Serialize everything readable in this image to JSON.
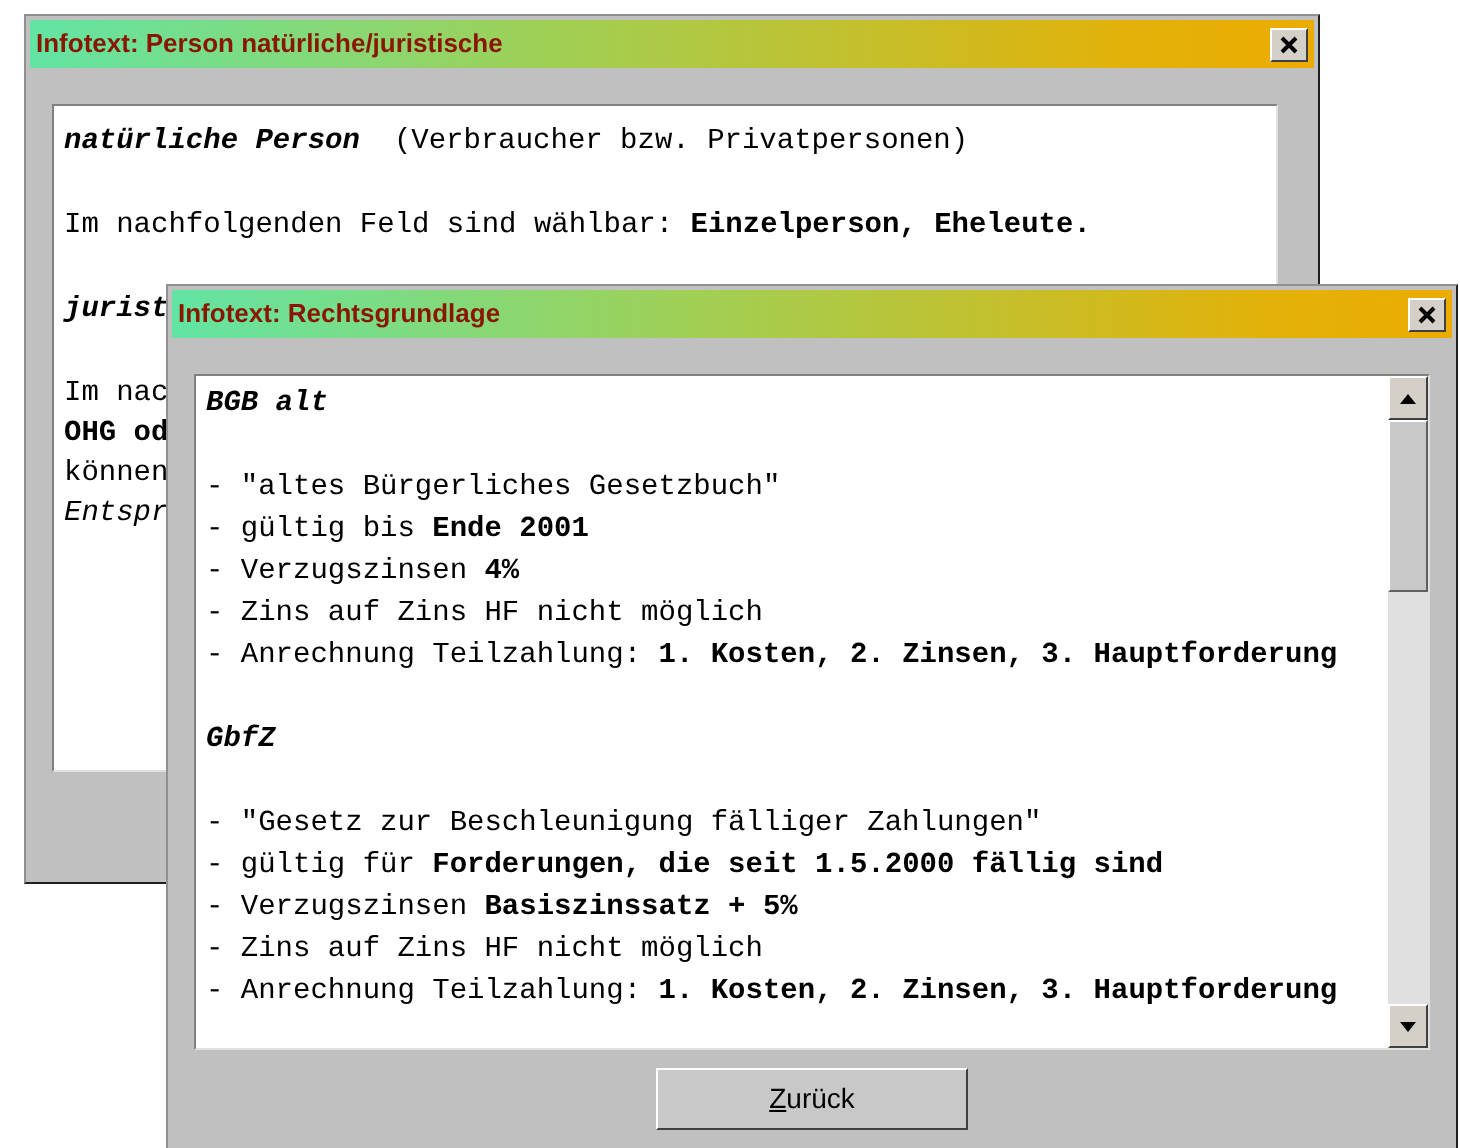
{
  "windows": [
    {
      "title": "Infotext: Person natürliche/juristische",
      "scrollbar": false,
      "paragraphs": [
        [
          {
            "kind": "heading",
            "text": "natürliche Person",
            "note": "(Verbraucher bzw. Privatpersonen)"
          }
        ],
        [
          {
            "kind": "text",
            "text": "Im nachfolgenden Feld sind wählbar: **Einzelperson, Eheleute.**"
          }
        ],
        [
          {
            "kind": "heading",
            "text": "jurist"
          }
        ],
        [
          {
            "kind": "text",
            "text": "Im nac"
          },
          {
            "kind": "bold",
            "text": "OHG od"
          },
          {
            "kind": "text",
            "text": "können"
          },
          {
            "kind": "italic",
            "text": "Entspr"
          }
        ]
      ]
    },
    {
      "title": "Infotext: Rechtsgrundlage",
      "scrollbar": true,
      "button": "Zurück",
      "paragraphs": [
        [
          {
            "kind": "heading",
            "text": "BGB alt"
          }
        ],
        [
          {
            "kind": "text",
            "text": "- \"altes Bürgerliches Gesetzbuch\""
          },
          {
            "kind": "text",
            "text": "- gültig bis **Ende 2001**"
          },
          {
            "kind": "text",
            "text": "- Verzugszinsen **4%**"
          },
          {
            "kind": "text",
            "text": "- Zins auf Zins HF nicht möglich"
          },
          {
            "kind": "text",
            "text": "- Anrechnung Teilzahlung: **1. Kosten, 2. Zinsen, 3. Hauptforderung**"
          }
        ],
        [
          {
            "kind": "heading",
            "text": "GbfZ"
          }
        ],
        [
          {
            "kind": "text",
            "text": "- \"Gesetz zur Beschleunigung fälliger Zahlungen\""
          },
          {
            "kind": "text",
            "text": "- gültig für **Forderungen, die seit 1.5.2000 fällig sind**"
          },
          {
            "kind": "text",
            "text": "- Verzugszinsen **Basiszinssatz + 5%**"
          },
          {
            "kind": "text",
            "text": "- Zins auf Zins HF nicht möglich"
          },
          {
            "kind": "text",
            "text": "- Anrechnung Teilzahlung: **1. Kosten, 2. Zinsen, 3. Hauptforderung**"
          }
        ]
      ]
    }
  ]
}
